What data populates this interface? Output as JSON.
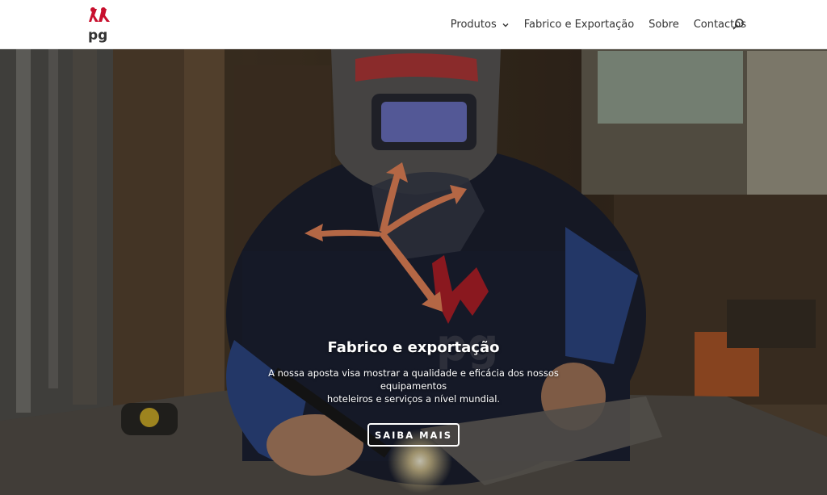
{
  "header": {
    "logo_text": "pg",
    "nav": [
      {
        "label": "Produtos",
        "has_dropdown": true
      },
      {
        "label": "Fabrico e Exportação",
        "has_dropdown": false
      },
      {
        "label": "Sobre",
        "has_dropdown": false
      },
      {
        "label": "Contactos",
        "has_dropdown": false
      }
    ],
    "search_icon": "search-icon"
  },
  "hero": {
    "title": "Fabrico e exportação",
    "text_line1": "A nossa aposta visa mostrar a qualidade e eficácia dos nossos equipamentos",
    "text_line2": "hoteleiros e serviços a nível mundial.",
    "button_label": "SAIBA MAIS"
  },
  "colors": {
    "brand_red": "#c8102e",
    "arrow_orange": "#f08a5d",
    "nav_text": "#333333"
  }
}
